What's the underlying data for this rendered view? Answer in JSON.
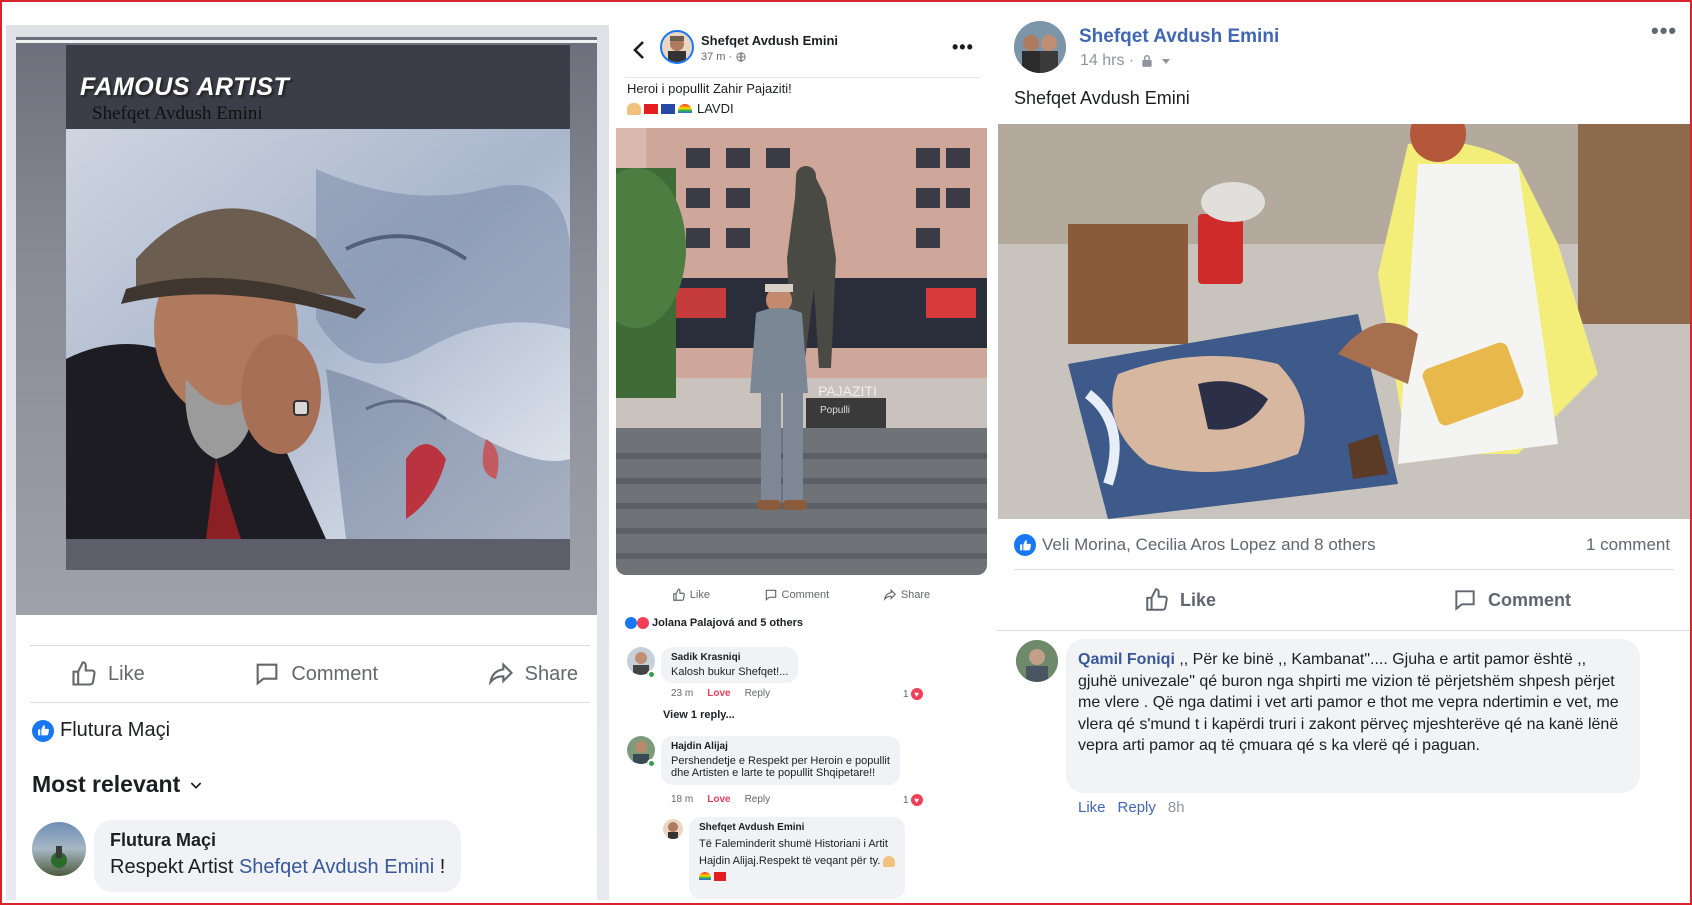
{
  "panel1": {
    "overlay_title": "FAMOUS ARTIST",
    "overlay_subtitle": "Shefqet Avdush Emini",
    "actions": {
      "like": "Like",
      "comment": "Comment",
      "share": "Share"
    },
    "reactor": "Flutura Maçi",
    "sort_label": "Most relevant",
    "comment": {
      "author": "Flutura Maçi",
      "text_prefix": "Respekt Artist ",
      "mention": "Shefqet Avdush Emini",
      "text_suffix": " !"
    }
  },
  "panel2": {
    "author": "Shefqet Avdush Emini",
    "time": "37 m ·",
    "post_line1": "Heroi i popullit Zahir Pajaziti!",
    "post_line2_text": "LAVDI",
    "statue_plaque_1": "PAJAZITI",
    "statue_plaque_2": "Populli",
    "actions": {
      "like": "Like",
      "comment": "Comment",
      "share": "Share"
    },
    "reactions_summary": "Jolana Palajová and 5 others",
    "comments": [
      {
        "author": "Sadik Krasniqi",
        "text": "Kalosh bukur Shefqet!...",
        "time": "23 m",
        "love": "Love",
        "reply": "Reply",
        "count": "1"
      },
      {
        "author": "Hajdin Alijaj",
        "text_line1": "Pershendetje e Respekt per Heroin e popullit",
        "text_line2": "dhe Artisten e larte te popullit Shqipetare!!",
        "time": "18 m",
        "love": "Love",
        "reply": "Reply",
        "count": "1"
      },
      {
        "author": "Shefqet Avdush Emini",
        "text_line1": "Të Faleminderit shumë Historiani i Artit",
        "text_line2": "Hajdin Alijaj.Respekt të veqant për ty."
      }
    ],
    "view_replies": "View 1 reply..."
  },
  "panel3": {
    "author": "Shefqet Avdush Emini",
    "time": "14 hrs ·",
    "caption": "Shefqet Avdush Emini",
    "reactors": "Veli Morina, Cecilia Aros Lopez and 8 others",
    "comment_count": "1 comment",
    "actions": {
      "like": "Like",
      "comment": "Comment"
    },
    "comment": {
      "author": "Qamil Foniqi",
      "text": " ,, Për ke binë ,, Kambanat\".... Gjuha e artit pamor është ,, gjuhë univezale\" qé buron nga shpirti me vizion të përjetshëm shpesh përjet me vlere . Që nga datimi i vet arti pamor e thot me vepra ndertimin e vet, me vlera qé s'mund t i kapërdi truri i zakont përveç mjeshterëve qé na kanë lënë vepra arti pamor aq të çmuara qé s ka vlerë qé i paguan.",
      "like": "Like",
      "reply": "Reply",
      "time": "8h"
    }
  },
  "colors": {
    "fb_blue": "#1877f2",
    "link_blue": "#385898",
    "name_blue": "#4267b2",
    "love_red": "#f33e58",
    "frame_red": "#d9232d"
  }
}
